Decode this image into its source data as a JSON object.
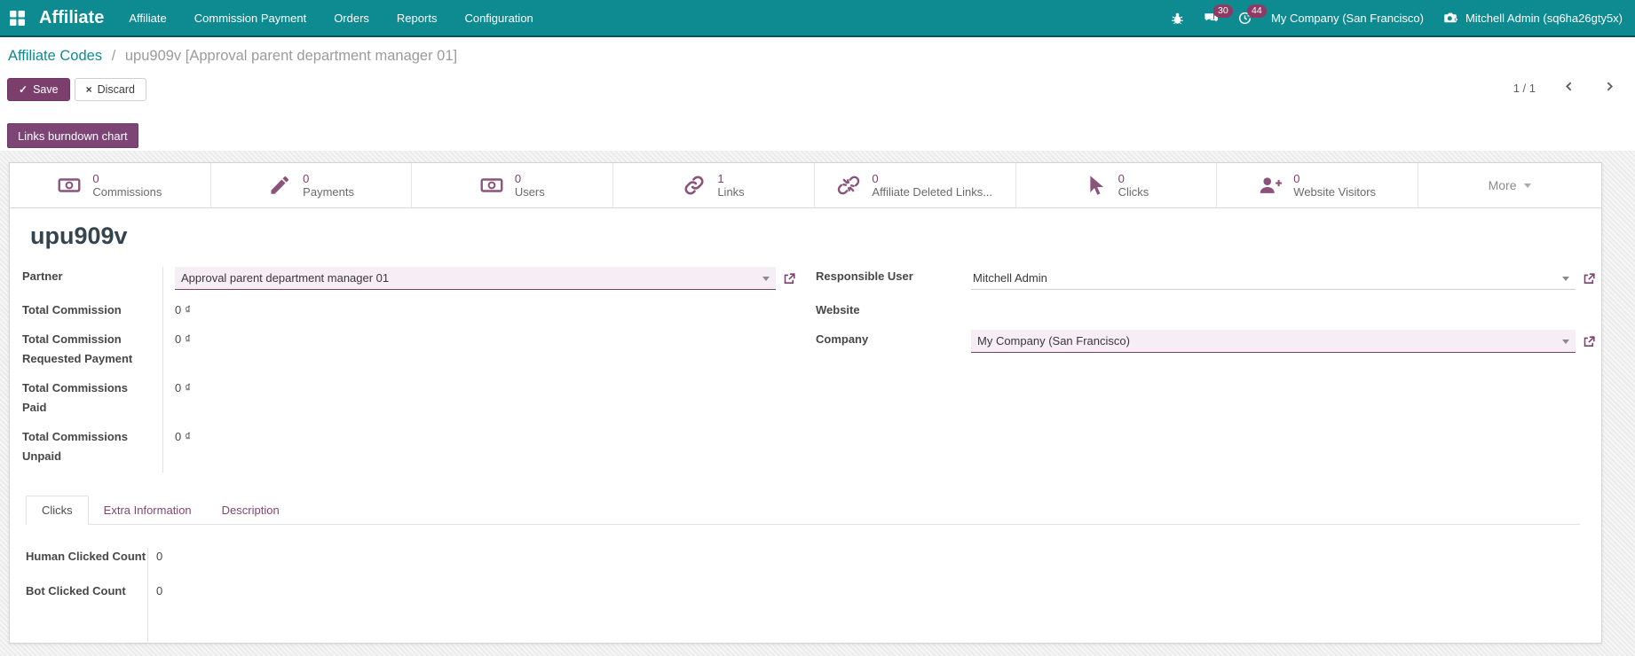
{
  "navbar": {
    "brand": "Affiliate",
    "menus": [
      "Affiliate",
      "Commission Payment",
      "Orders",
      "Reports",
      "Configuration"
    ],
    "messages_badge": "30",
    "activities_badge": "44",
    "company": "My Company (San Francisco)",
    "user": "Mitchell Admin (sq6ha26gty5x)"
  },
  "breadcrumb": {
    "parent": "Affiliate Codes",
    "separator": "/",
    "current": "upu909v [Approval parent department manager 01]"
  },
  "actions": {
    "save": "Save",
    "discard": "Discard"
  },
  "pager": {
    "value": "1 / 1"
  },
  "action_buttons": {
    "links_burndown": "Links burndown chart"
  },
  "stat_buttons": [
    {
      "icon": "money-icon",
      "value": "0",
      "label": "Commissions"
    },
    {
      "icon": "pencil-icon",
      "value": "0",
      "label": "Payments"
    },
    {
      "icon": "money-icon",
      "value": "0",
      "label": "Users"
    },
    {
      "icon": "chain-icon",
      "value": "1",
      "label": "Links"
    },
    {
      "icon": "chain-broken-icon",
      "value": "0",
      "label": "Affiliate Deleted Links..."
    },
    {
      "icon": "cursor-icon",
      "value": "0",
      "label": "Clicks"
    },
    {
      "icon": "user-plus-icon",
      "value": "0",
      "label": "Website Visitors"
    }
  ],
  "more_button": "More",
  "form": {
    "title": "upu909v",
    "partner": {
      "label": "Partner",
      "value": "Approval parent department manager 01"
    },
    "total_commission": {
      "label": "Total Commission",
      "value": "0 ₫"
    },
    "total_commission_requested": {
      "label": "Total Commission Requested Payment",
      "value": "0 ₫"
    },
    "total_commissions_paid": {
      "label": "Total Commissions Paid",
      "value": "0 ₫"
    },
    "total_commissions_unpaid": {
      "label": "Total Commissions Unpaid",
      "value": "0 ₫"
    },
    "responsible_user": {
      "label": "Responsible User",
      "value": "Mitchell Admin"
    },
    "website": {
      "label": "Website",
      "value": ""
    },
    "company": {
      "label": "Company",
      "value": "My Company (San Francisco)"
    }
  },
  "tabs": {
    "clicks": "Clicks",
    "extra": "Extra Information",
    "description": "Description"
  },
  "clicks_tab": {
    "human": {
      "label": "Human Clicked Count",
      "value": "0"
    },
    "bot": {
      "label": "Bot Clicked Count",
      "value": "0"
    }
  },
  "colors": {
    "navbar": "#0e8a91",
    "primary": "#7c3f6d",
    "badge": "#8f3a64",
    "stat_icon": "#8b537b"
  }
}
